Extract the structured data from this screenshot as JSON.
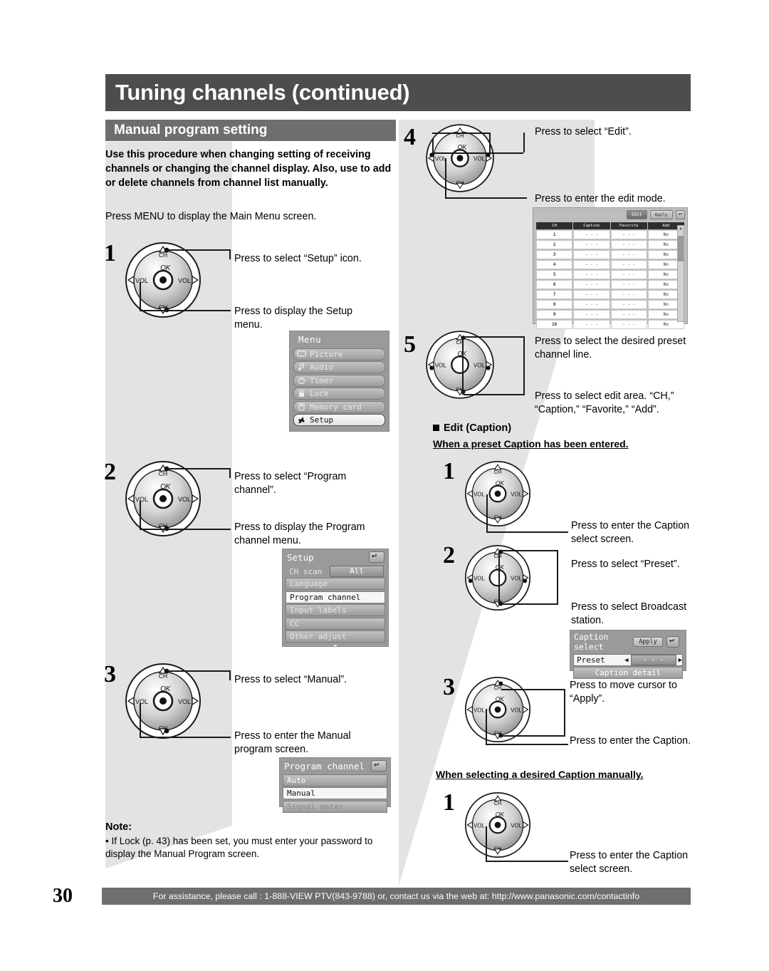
{
  "page": {
    "title": "Tuning channels (continued)",
    "section_title": "Manual program setting",
    "number": "30"
  },
  "intro": {
    "bold": "Use this procedure when changing setting of receiving channels or changing the channel display. Also, use to add or delete channels from channel list manually.",
    "lead": "Press MENU to display the Main Menu screen."
  },
  "left_steps": {
    "s1_num": "1",
    "s1_a": "Press to select “Setup” icon.",
    "s1_b": "Press to display the Setup menu.",
    "s2_num": "2",
    "s2_a": "Press to select “Program channel”.",
    "s2_b": "Press to display the Program channel menu.",
    "s3_num": "3",
    "s3_a": "Press to select “Manual”.",
    "s3_b": "Press to enter the Manual program screen."
  },
  "right_steps": {
    "s4_num": "4",
    "s4_a": "Press to select “Edit”.",
    "s4_b": "Press to enter the edit mode.",
    "s5_num": "5",
    "s5_a": "Press to select the desired preset channel line.",
    "s5_b": "Press to select edit area. “CH,” “Caption,” “Favorite,” “Add”."
  },
  "edit_caption": {
    "heading": "Edit (Caption)",
    "subheading_preset": "When a preset Caption has been entered.",
    "e1_num": "1",
    "e1_text": "Press to enter the Caption select screen.",
    "e2_num": "2",
    "e2_a": "Press to select “Preset”.",
    "e2_b": "Press to select Broadcast station.",
    "e3_num": "3",
    "e3_a": "Press to move cursor to “Apply”.",
    "e3_b": "Press to enter the Caption.",
    "subheading_manual": "When selecting a desired Caption manually.",
    "m1_num": "1",
    "m1_text": "Press to enter the Caption select screen."
  },
  "dial": {
    "ch_top": "CH",
    "ch_bottom": "CH",
    "ok": "OK",
    "vol_left": "VOL",
    "vol_right": "VOL"
  },
  "menu_screen": {
    "title": "Menu",
    "items": [
      {
        "label": "Picture",
        "icon": "display-icon",
        "selected": false
      },
      {
        "label": "Audio",
        "icon": "note-icon",
        "selected": false
      },
      {
        "label": "Timer",
        "icon": "power-icon",
        "selected": false
      },
      {
        "label": "Lock",
        "icon": "lock-icon",
        "selected": false
      },
      {
        "label": "Memory card",
        "icon": "card-icon",
        "selected": false
      },
      {
        "label": "Setup",
        "icon": "wrench-icon",
        "selected": true
      }
    ]
  },
  "setup_screen": {
    "title": "Setup",
    "ch_scan_label": "CH scan",
    "ch_scan_value": "All",
    "items": [
      {
        "label": "Language",
        "selected": false
      },
      {
        "label": "Program channel",
        "selected": true
      },
      {
        "label": "Input labels",
        "selected": false
      },
      {
        "label": "CC",
        "selected": false
      },
      {
        "label": "Other adjust",
        "selected": false
      }
    ],
    "more": "▼"
  },
  "program_screen": {
    "title": "Program channel",
    "items": [
      {
        "label": "Auto",
        "selected": false,
        "disabled": false
      },
      {
        "label": "Manual",
        "selected": true,
        "disabled": false
      },
      {
        "label": "Signal meter",
        "selected": false,
        "disabled": true
      }
    ]
  },
  "channel_table": {
    "buttons": {
      "edit": "Edit",
      "apply": "Apply",
      "back": "↩"
    },
    "columns": [
      "CH",
      "Caption",
      "Favorite",
      "Add"
    ],
    "rows": [
      [
        "1",
        "- - -",
        "- - -",
        "No"
      ],
      [
        "2",
        "- - -",
        "- - -",
        "No"
      ],
      [
        "3",
        "- - -",
        "- - -",
        "No"
      ],
      [
        "4",
        "- - -",
        "- - -",
        "No"
      ],
      [
        "5",
        "- - -",
        "- - -",
        "No"
      ],
      [
        "6",
        "- - -",
        "- - -",
        "No"
      ],
      [
        "7",
        "- - -",
        "- - -",
        "No"
      ],
      [
        "8",
        "- - -",
        "- - -",
        "No"
      ],
      [
        "9",
        "- - -",
        "- - -",
        "No"
      ],
      [
        "10",
        "- - -",
        "- - -",
        "No"
      ]
    ],
    "scroll_up": "▲",
    "scroll_down": "▼"
  },
  "caption_select_screen": {
    "title": "Caption select",
    "apply": "Apply",
    "preset_label": "Preset",
    "preset_value": "- - -",
    "arrow_left": "◀",
    "arrow_right": "▶",
    "detail_label": "Caption detail"
  },
  "note": {
    "label": "Note:",
    "text": "• If Lock (p. 43) has been set, you must enter your password to display the Manual Program screen."
  },
  "footer": {
    "text": "For assistance, please call : 1-888-VIEW PTV(843-9788) or, contact us via the web at: http://www.panasonic.com/contactinfo"
  }
}
